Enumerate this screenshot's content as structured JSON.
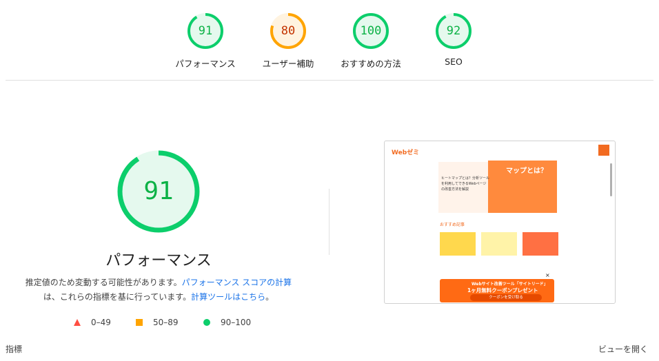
{
  "categories": [
    {
      "score": "91",
      "label": "パフォーマンス",
      "fraction": 0.91,
      "color": "#0cce6b",
      "text_color": "#0cb246",
      "fill": "#e5f9ee"
    },
    {
      "score": "80",
      "label": "ユーザー補助",
      "fraction": 0.8,
      "color": "#ffa400",
      "text_color": "#c33300",
      "fill": "#fff3e0"
    },
    {
      "score": "100",
      "label": "おすすめの方法",
      "fraction": 1.0,
      "color": "#0cce6b",
      "text_color": "#0cb246",
      "fill": "#e5f9ee"
    },
    {
      "score": "92",
      "label": "SEO",
      "fraction": 0.92,
      "color": "#0cce6b",
      "text_color": "#0cb246",
      "fill": "#e5f9ee"
    }
  ],
  "main": {
    "score": "91",
    "fraction": 0.91,
    "title": "パフォーマンス",
    "desc_1": "推定値のため変動する可能性があります。",
    "link_calc": "パフォーマンス スコアの計算",
    "desc_2": "は、これらの指標を基に行っています。",
    "link_tool": "計算ツールはこちら",
    "desc_3": "。"
  },
  "legend": [
    {
      "range": "0–49",
      "icon": "triangle-icon",
      "color": "#ff4e42"
    },
    {
      "range": "50–89",
      "icon": "square-icon",
      "color": "#ffa400"
    },
    {
      "range": "90–100",
      "icon": "circle-icon",
      "color": "#0cce6b"
    }
  ],
  "screenshot": {
    "logo": "Webゼミ",
    "hero_text": "ヒートマップとは？分析ツールを利用してできるWebページの改善方法を解説",
    "hero_big": "マップとは？",
    "section": "おすすめ記事",
    "banner_line1": "Webサイト改善ツール「サイトリード」",
    "banner_line2": "1ヶ月無料クーポンプレゼント",
    "banner_button": "クーポンを受け取る",
    "close": "×"
  },
  "footer": {
    "metrics_label": "指標",
    "view_toggle": "ビューを開く"
  }
}
